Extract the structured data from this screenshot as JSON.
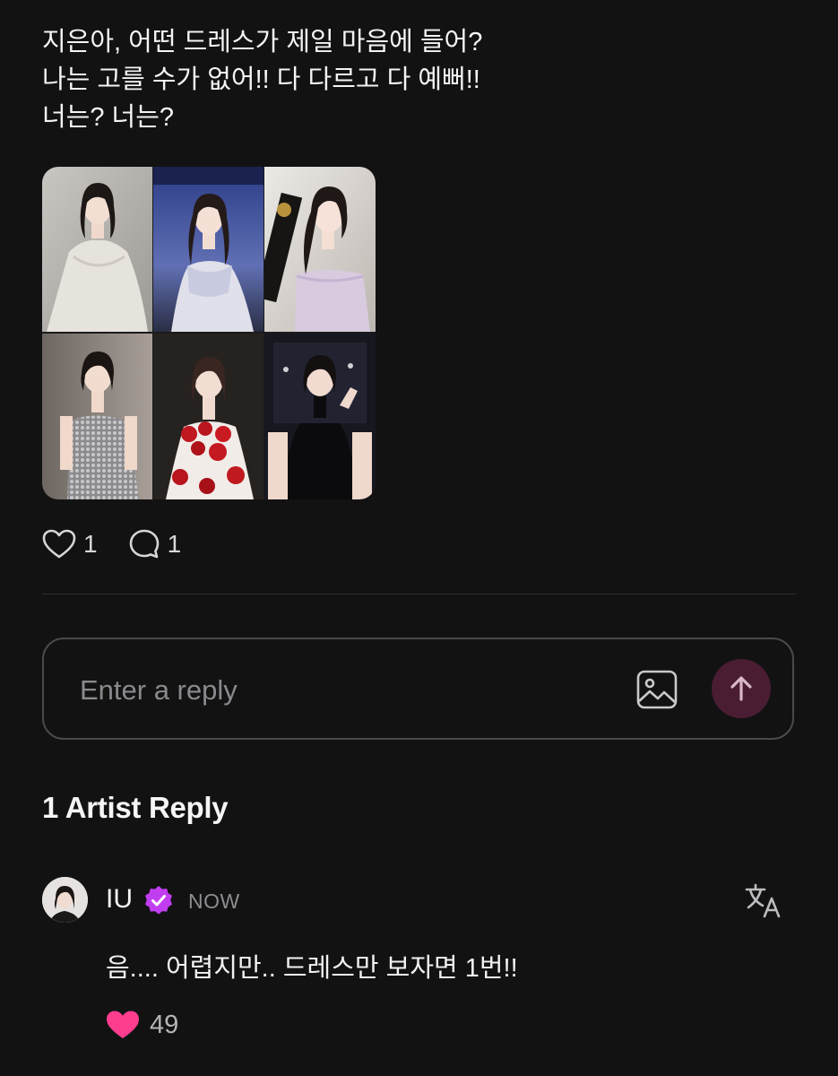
{
  "post": {
    "lines": [
      "지은아, 어떤 드레스가 제일 마음에 들어?",
      "나는 고를 수가 없어!! 다 다르고 다 예뻐!!",
      "너는? 너는?"
    ],
    "photos": [
      {
        "dress": "silver lace gown, light backdrop"
      },
      {
        "dress": "white sparkling tulle gown, blue stage backdrop"
      },
      {
        "dress": "lavender strapless dress holding award"
      },
      {
        "dress": "silver sequin strapless dress, concrete wall"
      },
      {
        "dress": "white gown with red petals, dark backdrop"
      },
      {
        "dress": "black halter dress, dark backdrop"
      }
    ],
    "like_count": "1",
    "comment_count": "1"
  },
  "reply": {
    "placeholder": "Enter a reply"
  },
  "artist_replies": {
    "title": "1 Artist Reply",
    "comment": {
      "author": "IU",
      "time": "NOW",
      "text": "음.... 어렵지만.. 드레스만 보자면 1번!!",
      "like_count": "49"
    }
  },
  "icons": {
    "like": "heart-outline-icon",
    "comment": "speech-bubble-icon",
    "image": "image-icon",
    "send": "arrow-up-icon",
    "verified": "verified-badge-icon",
    "translate": "translate-icon",
    "comment_like": "heart-filled-icon"
  },
  "colors": {
    "background": "#121213",
    "send_button": "#4a1d33",
    "verified_badge": "#c13df0",
    "comment_heart": "#ff3d8f"
  }
}
